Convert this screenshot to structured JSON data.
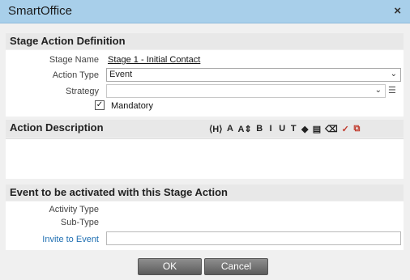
{
  "window": {
    "title": "SmartOffice",
    "close_glyph": "×"
  },
  "stage_definition": {
    "heading": "Stage Action Definition",
    "stage_name_label": "Stage Name",
    "stage_name_value": "Stage 1 - Initial Contact",
    "action_type_label": "Action Type",
    "action_type_value": "Event",
    "strategy_label": "Strategy",
    "strategy_value": "",
    "mandatory_label": "Mandatory",
    "mandatory_checked": true
  },
  "description": {
    "heading": "Action Description",
    "toolbar": [
      {
        "name": "heading-icon",
        "glyph": "⟨H⟩"
      },
      {
        "name": "font-size-icon",
        "glyph": "A"
      },
      {
        "name": "font-resize-icon",
        "glyph": "A⇕"
      },
      {
        "name": "bold-icon",
        "glyph": "B"
      },
      {
        "name": "italic-icon",
        "glyph": "I"
      },
      {
        "name": "underline-icon",
        "glyph": "U"
      },
      {
        "name": "text-color-icon",
        "glyph": "T"
      },
      {
        "name": "highlight-icon",
        "glyph": "◆"
      },
      {
        "name": "paste-icon",
        "glyph": "▤"
      },
      {
        "name": "clear-format-icon",
        "glyph": "⌫"
      },
      {
        "name": "spellcheck-icon",
        "glyph": "✓"
      },
      {
        "name": "popout-icon",
        "glyph": "⧉"
      }
    ]
  },
  "event": {
    "heading": "Event to be activated with this Stage Action",
    "activity_type_label": "Activity Type",
    "sub_type_label": "Sub-Type",
    "invite_label": "Invite to Event",
    "invite_value": ""
  },
  "buttons": {
    "ok": "OK",
    "cancel": "Cancel"
  }
}
